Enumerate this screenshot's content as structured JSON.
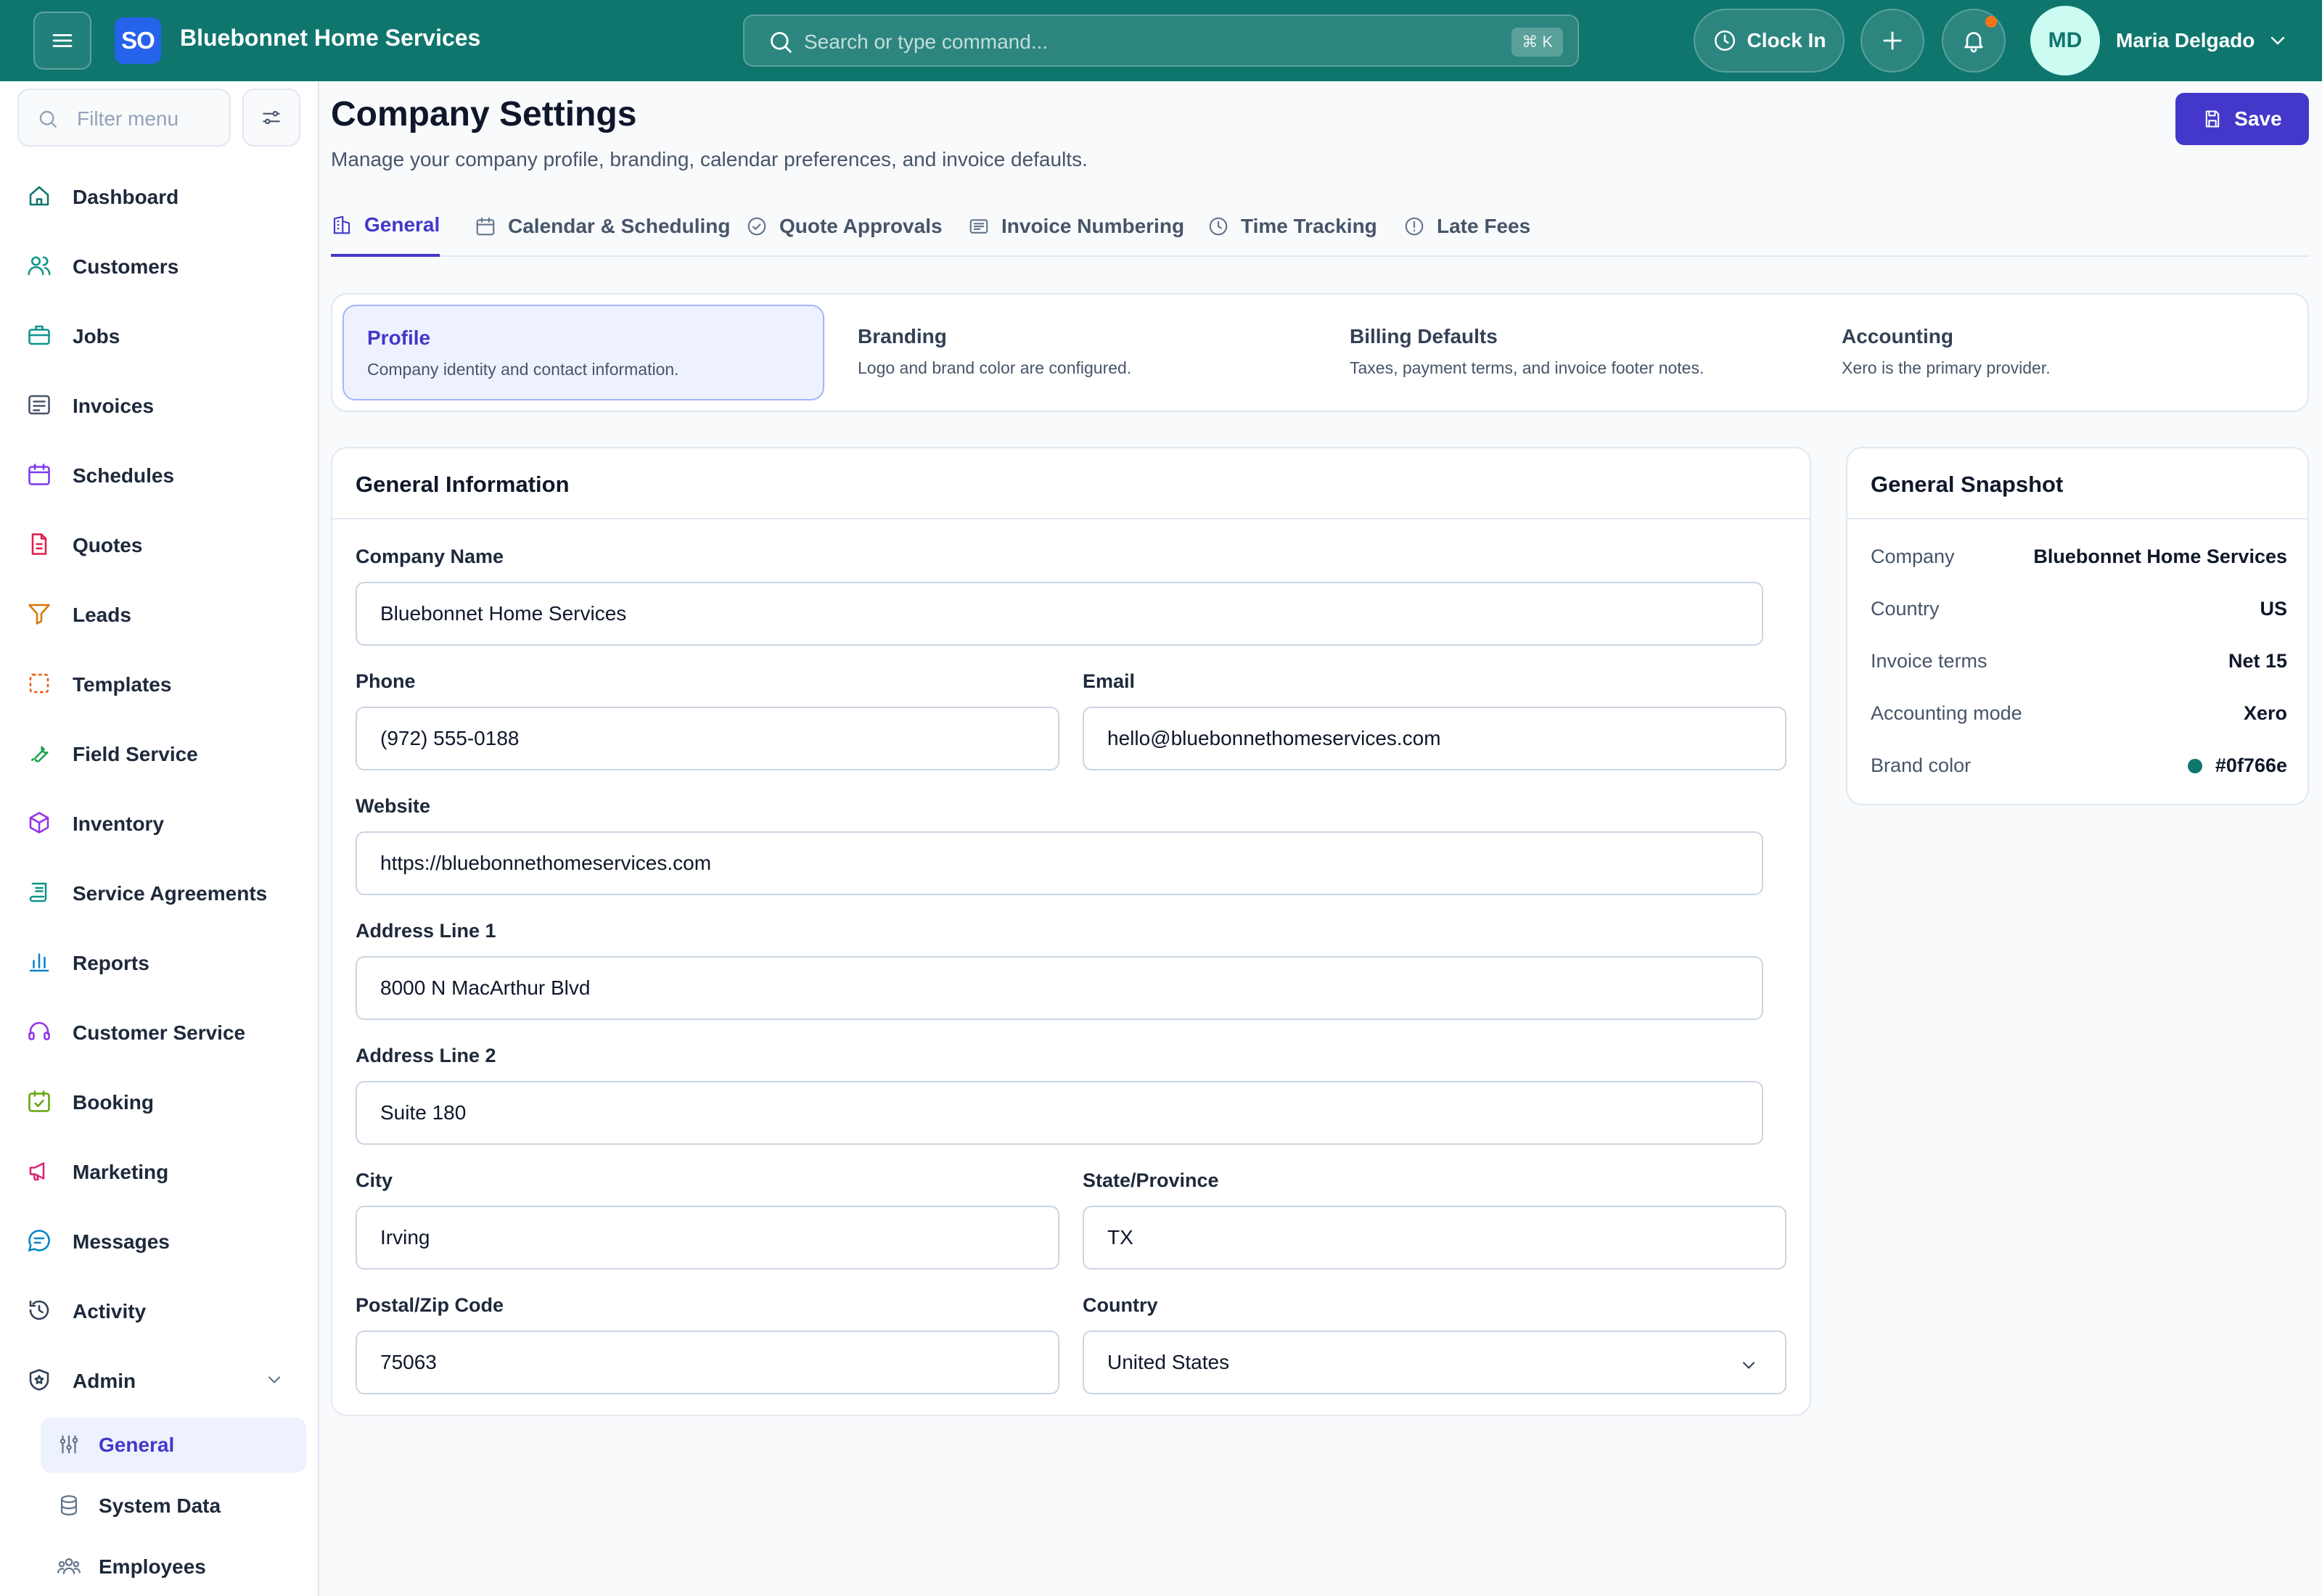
{
  "topbar": {
    "logo_initials": "SO",
    "brand_name": "Bluebonnet Home Services",
    "search_placeholder": "Search or type command...",
    "search_shortcut": "⌘ K",
    "clock_in_label": "Clock In",
    "user_initials": "MD",
    "user_name": "Maria Delgado"
  },
  "sidebar": {
    "filter_placeholder": "Filter menu",
    "items": [
      {
        "label": "Dashboard",
        "icon": "home-icon",
        "color": "#0f766e"
      },
      {
        "label": "Customers",
        "icon": "users-icon",
        "color": "#0d9488"
      },
      {
        "label": "Jobs",
        "icon": "briefcase-icon",
        "color": "#0d9488"
      },
      {
        "label": "Invoices",
        "icon": "invoice-icon",
        "color": "#475569"
      },
      {
        "label": "Schedules",
        "icon": "calendar-icon",
        "color": "#7c3aed"
      },
      {
        "label": "Quotes",
        "icon": "document-icon",
        "color": "#e11d48"
      },
      {
        "label": "Leads",
        "icon": "funnel-icon",
        "color": "#d97706"
      },
      {
        "label": "Templates",
        "icon": "template-icon",
        "color": "#ea580c"
      },
      {
        "label": "Field Service",
        "icon": "wrench-icon",
        "color": "#16a34a"
      },
      {
        "label": "Inventory",
        "icon": "box-icon",
        "color": "#9333ea"
      },
      {
        "label": "Service Agreements",
        "icon": "scroll-icon",
        "color": "#0d9488"
      },
      {
        "label": "Reports",
        "icon": "bar-chart-icon",
        "color": "#0284c7"
      },
      {
        "label": "Customer Service",
        "icon": "headset-icon",
        "color": "#9333ea"
      },
      {
        "label": "Booking",
        "icon": "calendar-check-icon",
        "color": "#65a30d"
      },
      {
        "label": "Marketing",
        "icon": "megaphone-icon",
        "color": "#db2777"
      },
      {
        "label": "Messages",
        "icon": "chat-icon",
        "color": "#0284c7"
      },
      {
        "label": "Activity",
        "icon": "history-icon",
        "color": "#334155"
      },
      {
        "label": "Admin",
        "icon": "shield-icon",
        "color": "#334155"
      }
    ],
    "admin_sub": [
      {
        "label": "General",
        "icon": "sliders-icon"
      },
      {
        "label": "System Data",
        "icon": "database-icon"
      },
      {
        "label": "Employees",
        "icon": "people-icon"
      }
    ]
  },
  "page": {
    "title": "Company Settings",
    "subtitle": "Manage your company profile, branding, calendar preferences, and invoice defaults.",
    "save_label": "Save"
  },
  "tabs": [
    {
      "label": "General",
      "icon": "building-icon"
    },
    {
      "label": "Calendar & Scheduling",
      "icon": "calendar-icon"
    },
    {
      "label": "Quote Approvals",
      "icon": "check-circle-icon"
    },
    {
      "label": "Invoice Numbering",
      "icon": "list-numbers-icon"
    },
    {
      "label": "Time Tracking",
      "icon": "clock-icon"
    },
    {
      "label": "Late Fees",
      "icon": "alert-circle-icon"
    }
  ],
  "sections": [
    {
      "title": "Profile",
      "desc": "Company identity and contact information."
    },
    {
      "title": "Branding",
      "desc": "Logo and brand color are configured."
    },
    {
      "title": "Billing Defaults",
      "desc": "Taxes, payment terms, and invoice footer notes."
    },
    {
      "title": "Accounting",
      "desc": "Xero is the primary provider."
    }
  ],
  "form": {
    "header": "General Information",
    "company_name_label": "Company Name",
    "company_name": "Bluebonnet Home Services",
    "phone_label": "Phone",
    "phone": "(972) 555-0188",
    "email_label": "Email",
    "email": "hello@bluebonnethomeservices.com",
    "website_label": "Website",
    "website": "https://bluebonnethomeservices.com",
    "address1_label": "Address Line 1",
    "address1": "8000 N MacArthur Blvd",
    "address2_label": "Address Line 2",
    "address2": "Suite 180",
    "city_label": "City",
    "city": "Irving",
    "state_label": "State/Province",
    "state": "TX",
    "postal_label": "Postal/Zip Code",
    "postal": "75063",
    "country_label": "Country",
    "country": "United States"
  },
  "snapshot": {
    "header": "General Snapshot",
    "rows": [
      {
        "key": "Company",
        "value": "Bluebonnet Home Services"
      },
      {
        "key": "Country",
        "value": "US"
      },
      {
        "key": "Invoice terms",
        "value": "Net 15"
      },
      {
        "key": "Accounting mode",
        "value": "Xero"
      },
      {
        "key": "Brand color",
        "value": "#0f766e"
      }
    ],
    "brand_swatch": "#0f766e"
  },
  "colors": {
    "topbar": "#0f766e",
    "accent": "#4338ca",
    "logo": "#2563eb",
    "notification": "#f97316"
  }
}
